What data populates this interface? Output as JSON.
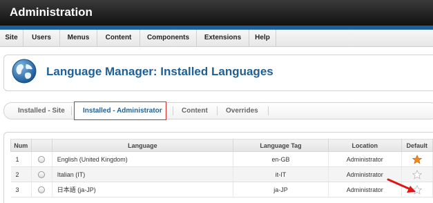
{
  "header": {
    "title": "Administration"
  },
  "menubar": {
    "items": [
      {
        "label": "Site"
      },
      {
        "label": "Users"
      },
      {
        "label": "Menus"
      },
      {
        "label": "Content"
      },
      {
        "label": "Components"
      },
      {
        "label": "Extensions"
      },
      {
        "label": "Help"
      }
    ]
  },
  "page": {
    "title": "Language Manager: Installed Languages",
    "icon": "globe-icon"
  },
  "tabs": [
    {
      "label": "Installed - Site",
      "active": false
    },
    {
      "label": "Installed - Administrator",
      "active": true
    },
    {
      "label": "Content",
      "active": false
    },
    {
      "label": "Overrides",
      "active": false
    }
  ],
  "table": {
    "columns": {
      "num": "Num",
      "language": "Language",
      "tag": "Language Tag",
      "location": "Location",
      "default": "Default"
    },
    "rows": [
      {
        "num": "1",
        "language": "English (United Kingdom)",
        "tag": "en-GB",
        "location": "Administrator",
        "default": true
      },
      {
        "num": "2",
        "language": "Italian (IT)",
        "tag": "it-IT",
        "location": "Administrator",
        "default": false
      },
      {
        "num": "3",
        "language": "日本語 (ja-JP)",
        "tag": "ja-JP",
        "location": "Administrator",
        "default": false
      }
    ]
  },
  "colors": {
    "title_blue": "#1f5f94",
    "accent_blue": "#1d5f9d",
    "highlight_red": "#d42a2a",
    "star_default": "#f08a1c"
  }
}
